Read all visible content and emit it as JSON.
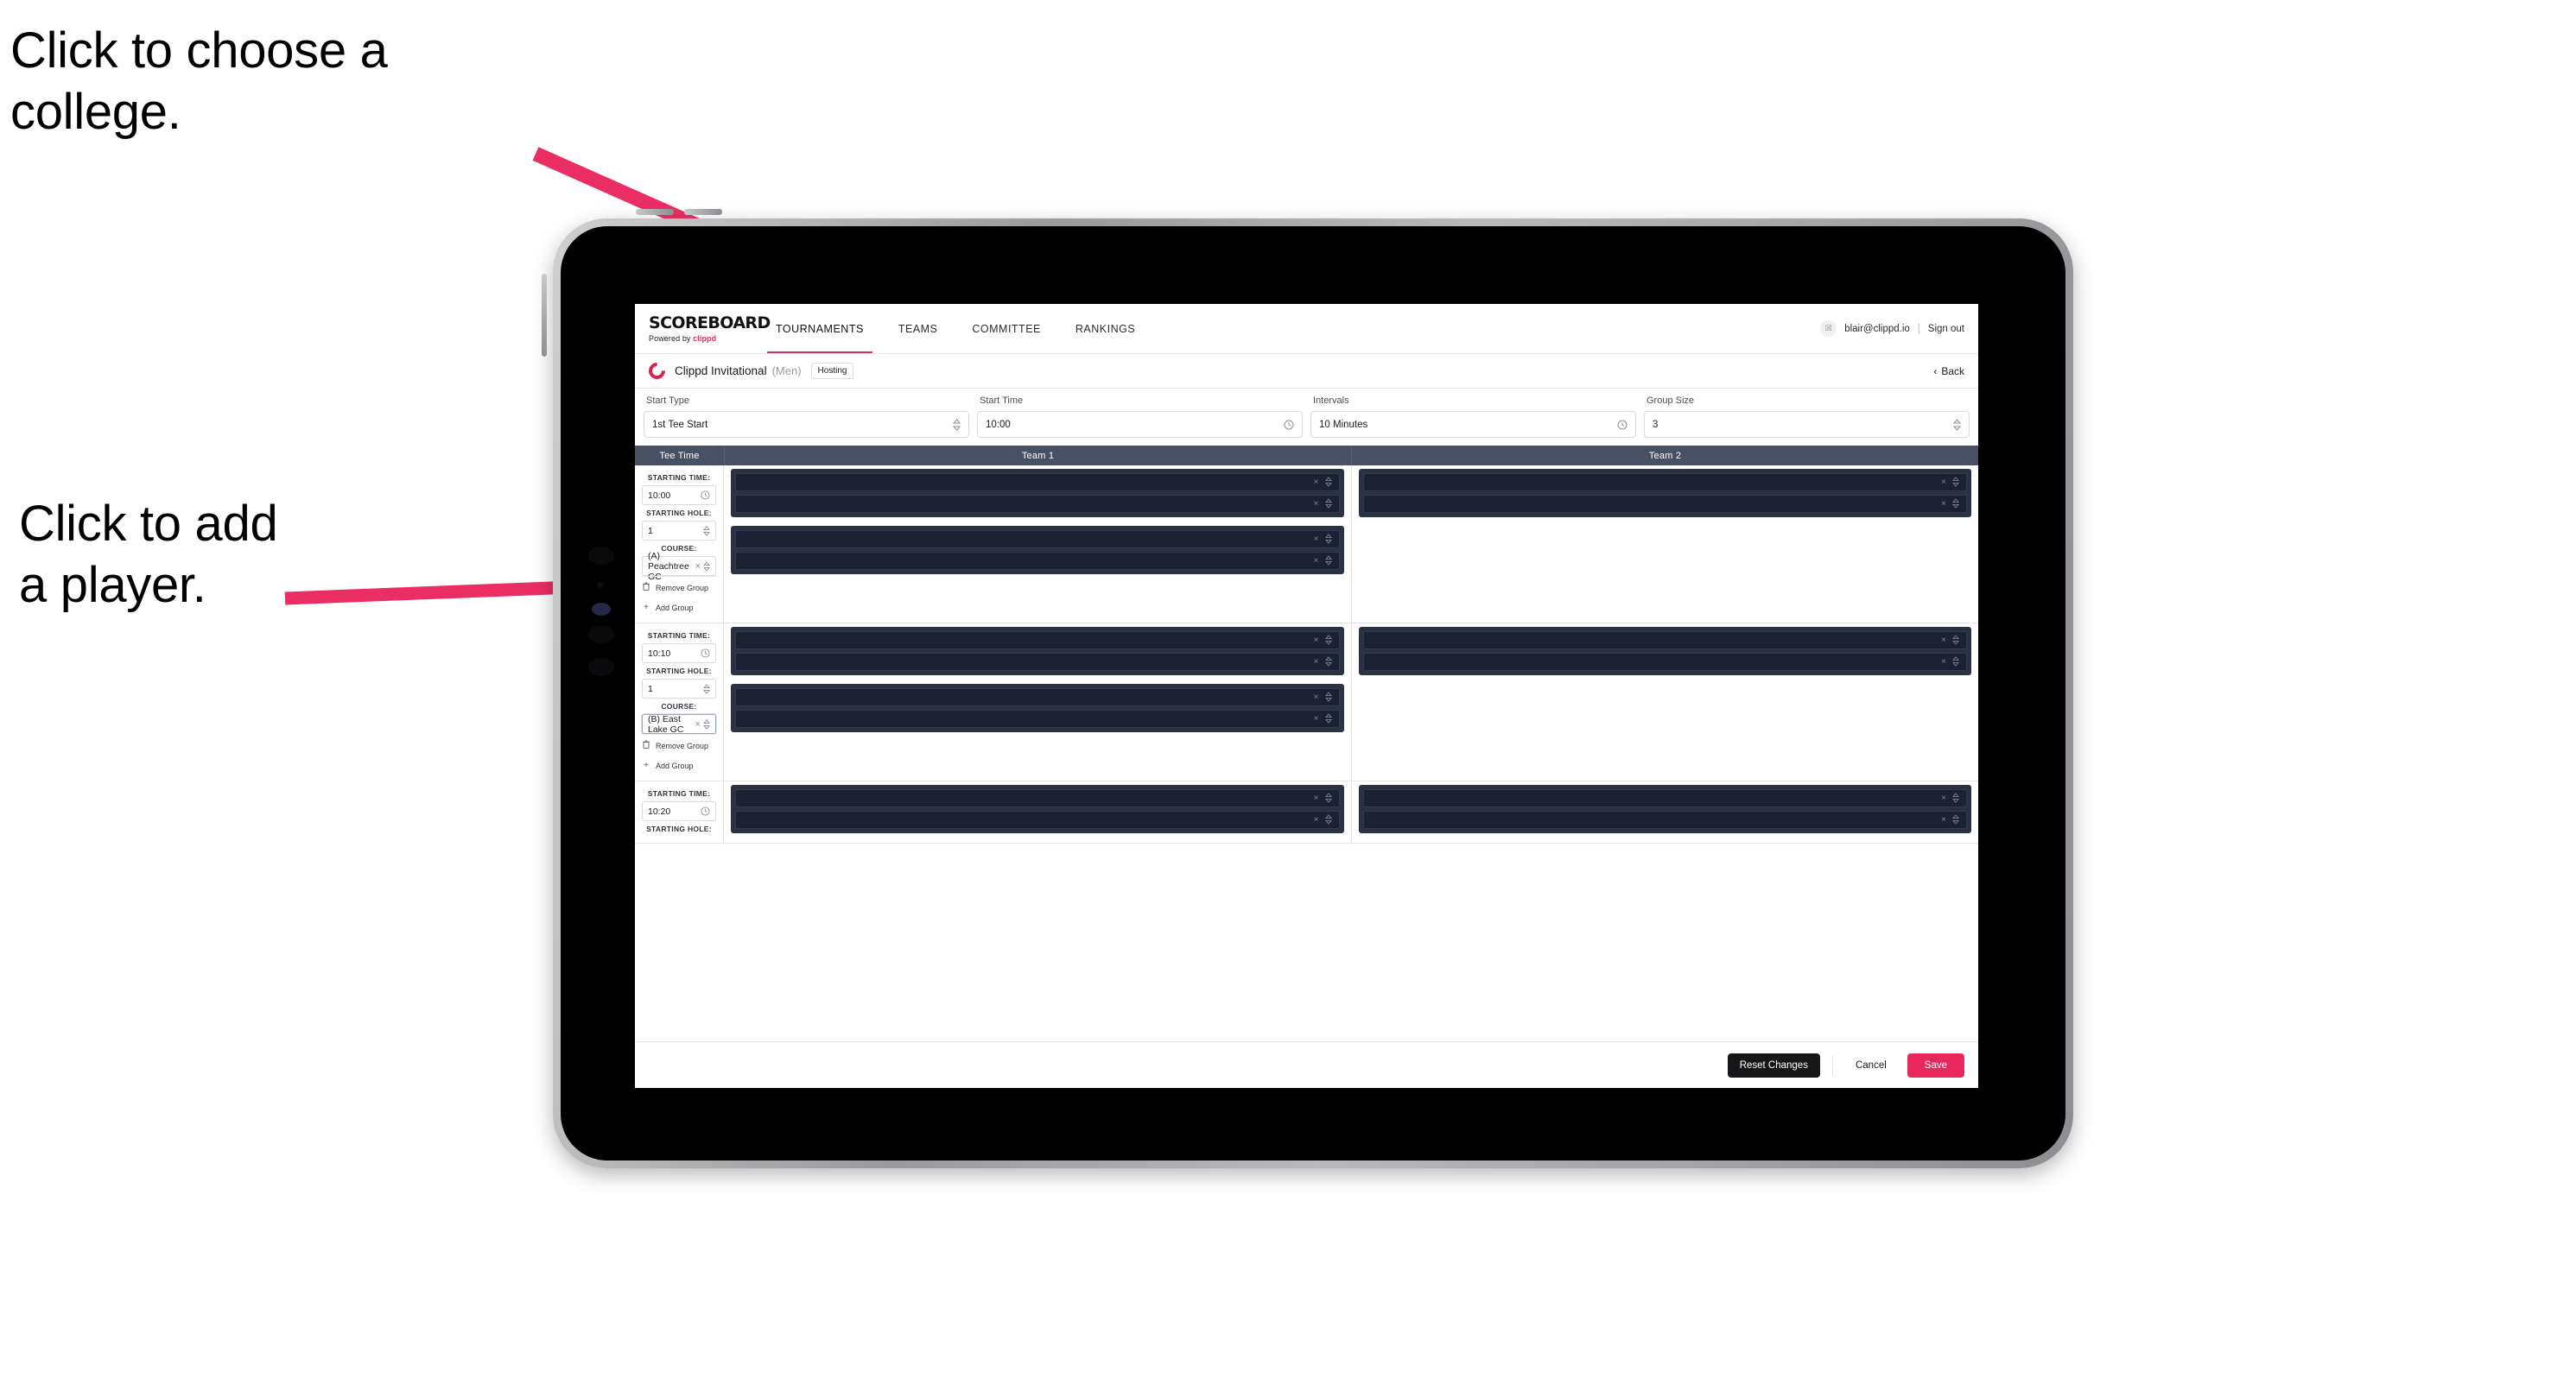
{
  "annotations": {
    "college": "Click to choose a\ncollege.",
    "player": "Click to add\na player."
  },
  "colors": {
    "accent_pink": "#e8285c",
    "arrow_pink": "#ea2e64",
    "table_header": "#4a5063",
    "slot_dark": "#1c2231",
    "group_dark": "#2a3142"
  },
  "nav": {
    "logo_word": "SCOREBOARD",
    "logo_sub_prefix": "Powered by ",
    "logo_sub_brand": "clippd",
    "links": [
      {
        "label": "TOURNAMENTS",
        "active": true
      },
      {
        "label": "TEAMS",
        "active": false
      },
      {
        "label": "COMMITTEE",
        "active": false
      },
      {
        "label": "RANKINGS",
        "active": false
      }
    ],
    "avatar_glyph": "☒",
    "email": "blair@clippd.io",
    "divider": "|",
    "sign_out": "Sign out"
  },
  "titlebar": {
    "logo_letter": "C",
    "tournament_name": "Clippd Invitational",
    "gender": "(Men)",
    "badge": "Hosting",
    "back_chevron": "‹",
    "back_label": "Back"
  },
  "filters": [
    {
      "label": "Start Type",
      "value": "1st Tee Start",
      "icon": "⌃⌄",
      "icon_name": "stepper-icon"
    },
    {
      "label": "Start Time",
      "value": "10:00",
      "icon": "◴",
      "icon_name": "clock-icon"
    },
    {
      "label": "Intervals",
      "value": "10 Minutes",
      "icon": "◴",
      "icon_name": "clock-icon"
    },
    {
      "label": "Group Size",
      "value": "3",
      "icon": "⌃⌄",
      "icon_name": "stepper-icon"
    }
  ],
  "table": {
    "headers": [
      "Tee Time",
      "Team 1",
      "Team 2"
    ],
    "labels": {
      "starting_time": "STARTING TIME:",
      "starting_hole": "STARTING HOLE:",
      "course": "COURSE:",
      "remove_group": "Remove Group",
      "add_group": "Add Group",
      "remove_icon": "Ὕ1",
      "add_icon": "+",
      "clear_icon": "×",
      "chevron_icon": "⌃⌄",
      "clock_icon": "◴"
    },
    "rows": [
      {
        "starting_time": "10:00",
        "starting_hole": "1",
        "course": "(A) Peachtree GC",
        "course_focused": false,
        "team1_groups": [
          {
            "slots": [
              "",
              ""
            ]
          },
          {
            "slots": [
              "",
              ""
            ]
          }
        ],
        "team2_groups": [
          {
            "slots": [
              "",
              ""
            ]
          }
        ]
      },
      {
        "starting_time": "10:10",
        "starting_hole": "1",
        "course": "(B) East Lake GC",
        "course_focused": true,
        "team1_groups": [
          {
            "slots": [
              "",
              ""
            ]
          },
          {
            "slots": [
              "",
              ""
            ]
          }
        ],
        "team2_groups": [
          {
            "slots": [
              "",
              ""
            ]
          }
        ]
      },
      {
        "starting_time": "10:20",
        "starting_hole": "",
        "course": "",
        "course_focused": false,
        "partial": true,
        "team1_groups": [
          {
            "slots": [
              "",
              ""
            ]
          }
        ],
        "team2_groups": [
          {
            "slots": [
              "",
              ""
            ]
          }
        ]
      }
    ]
  },
  "footer": {
    "reset": "Reset Changes",
    "cancel": "Cancel",
    "save": "Save"
  }
}
